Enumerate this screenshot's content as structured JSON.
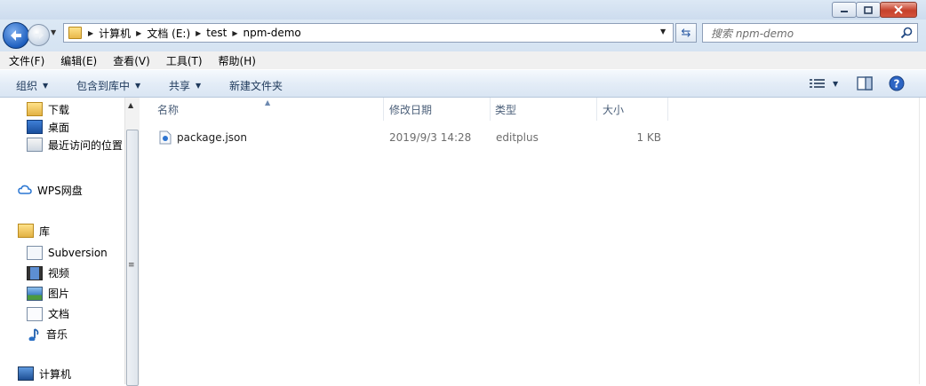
{
  "window": {
    "caption_buttons": [
      "minimize-icon",
      "maximize-icon",
      "close-icon"
    ]
  },
  "address": {
    "segments": [
      "计算机",
      "文档 (E:)",
      "test",
      "npm-demo"
    ],
    "search_placeholder": "搜索 npm-demo"
  },
  "menubar": {
    "items": [
      "文件(F)",
      "编辑(E)",
      "查看(V)",
      "工具(T)",
      "帮助(H)"
    ]
  },
  "toolbar": {
    "organize": "组织",
    "include_library": "包含到库中",
    "share": "共享",
    "new_folder": "新建文件夹"
  },
  "nav": {
    "favorites": [
      {
        "label": "下载",
        "icon": "download-folder-icon"
      },
      {
        "label": "桌面",
        "icon": "desktop-icon"
      },
      {
        "label": "最近访问的位置",
        "icon": "recent-places-icon"
      }
    ],
    "wps": {
      "label": "WPS网盘",
      "icon": "cloud-icon"
    },
    "library": {
      "label": "库",
      "icon": "library-icon"
    },
    "libraries": [
      {
        "label": "Subversion",
        "icon": "document-library-icon"
      },
      {
        "label": "视频",
        "icon": "video-icon"
      },
      {
        "label": "图片",
        "icon": "pictures-icon"
      },
      {
        "label": "文档",
        "icon": "documents-icon"
      },
      {
        "label": "音乐",
        "icon": "music-icon"
      }
    ],
    "computer": {
      "label": "计算机",
      "icon": "computer-icon"
    }
  },
  "columns": {
    "name": "名称",
    "modified": "修改日期",
    "type": "类型",
    "size": "大小"
  },
  "files": [
    {
      "name": "package.json",
      "modified": "2019/9/3 14:28",
      "type": "editplus",
      "size": "1 KB",
      "icon": "editplus-file-icon"
    }
  ]
}
